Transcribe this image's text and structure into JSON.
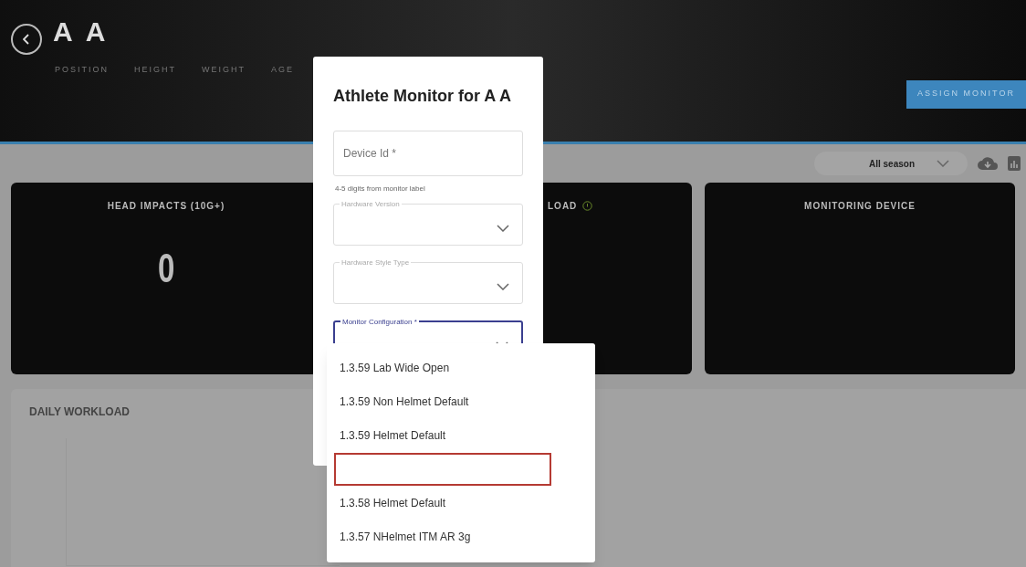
{
  "athlete": {
    "name": "A A",
    "fields": [
      "POSITION",
      "HEIGHT",
      "WEIGHT",
      "AGE"
    ]
  },
  "assign_button": "ASSIGN MONITOR",
  "season_select": {
    "value": "All season"
  },
  "cards": [
    {
      "title": "HEAD IMPACTS (10G+)",
      "value": "0"
    },
    {
      "title": "LOAD",
      "info": true
    },
    {
      "title": "MONITORING DEVICE"
    }
  ],
  "daily_workload": {
    "title": "DAILY WORKLOAD"
  },
  "modal": {
    "title": "Athlete Monitor for A A",
    "fields": [
      {
        "kind": "text",
        "placeholder": "Device Id *",
        "helper": "4-5 digits from monitor label",
        "focused": false
      },
      {
        "kind": "select",
        "label": "Hardware Version",
        "focused": false
      },
      {
        "kind": "select",
        "label": "Hardware Style Type",
        "focused": false
      },
      {
        "kind": "select",
        "label": "Monitor Configuration *",
        "focused": true
      }
    ]
  },
  "dropdown": {
    "options": [
      {
        "kind": "option",
        "label": "1.3.59 Lab Wide Open"
      },
      {
        "kind": "option",
        "label": "1.3.59 Non Helmet Default"
      },
      {
        "kind": "option",
        "label": "1.3.59 Helmet Default"
      },
      {
        "kind": "marked"
      },
      {
        "kind": "option",
        "label": "1.3.58 Helmet Default"
      },
      {
        "kind": "option",
        "label": "1.3.57 NHelmet ITM AR 3g"
      }
    ]
  }
}
